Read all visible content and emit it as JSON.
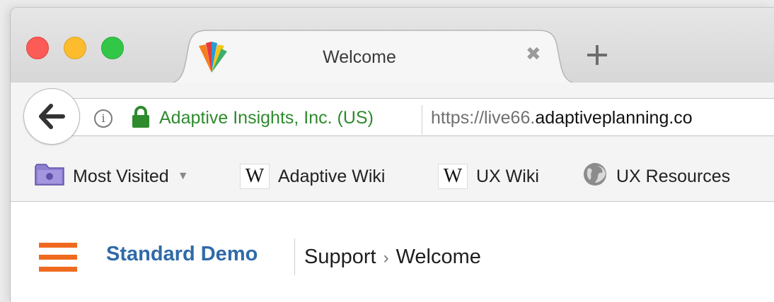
{
  "browser": {
    "tab": {
      "title": "Welcome",
      "close_glyph": "✖",
      "logo": "adaptive-insights-logo"
    },
    "new_tab_icon": "plus-icon",
    "address_bar": {
      "identity": "Adaptive Insights, Inc. (US)",
      "url_prefix": "https://live66.",
      "url_domain": "adaptiveplanning.co"
    },
    "bookmarks": [
      {
        "label": "Most Visited",
        "icon": "folder-icon"
      },
      {
        "label": "Adaptive Wiki",
        "icon": "wikipedia-icon",
        "icon_text": "W"
      },
      {
        "label": "UX Wiki",
        "icon": "wikipedia-icon",
        "icon_text": "W"
      },
      {
        "label": "UX Resources",
        "icon": "globe-icon"
      }
    ]
  },
  "app": {
    "org_name": "Standard Demo",
    "breadcrumb": {
      "parent": "Support",
      "separator": "›",
      "current": "Welcome"
    },
    "menu_icon": "hamburger-menu-icon"
  },
  "colors": {
    "accent_orange": "#ef6a1f",
    "brand_blue": "#2f6aa8",
    "secure_green": "#2e8b2e"
  }
}
